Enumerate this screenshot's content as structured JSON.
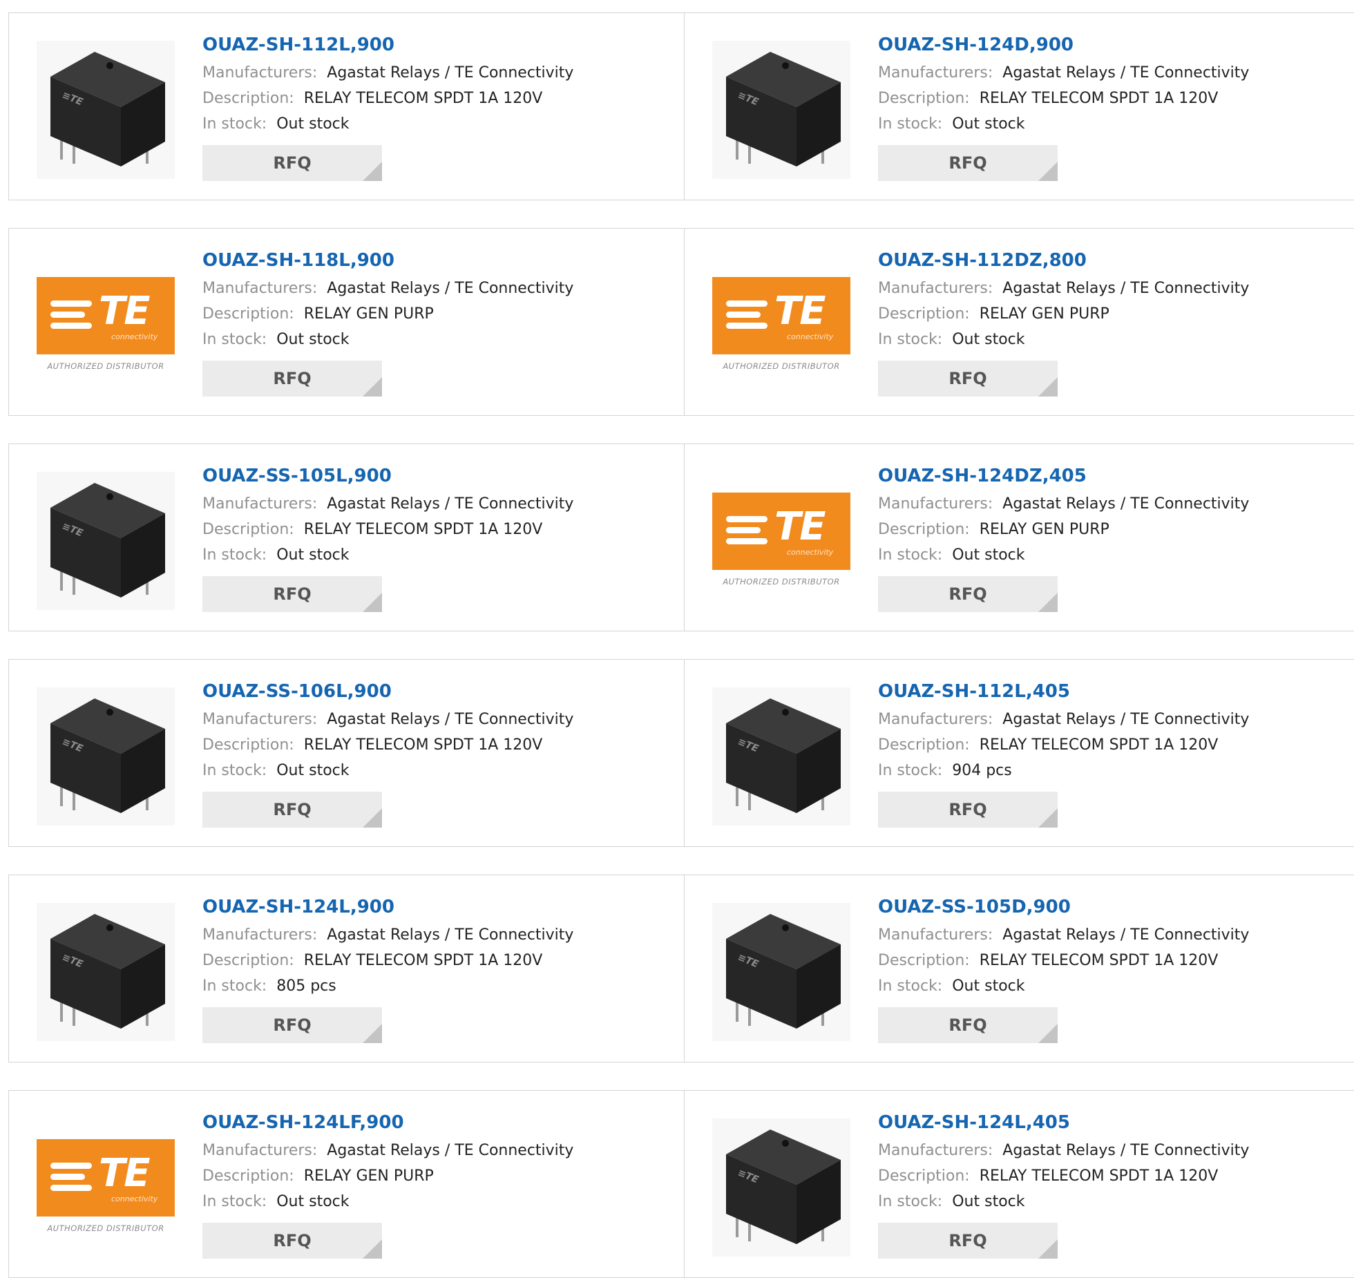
{
  "labels": {
    "manufacturers": "Manufacturers:",
    "description": "Description:",
    "stock": "In stock:",
    "rfq": "RFQ"
  },
  "logo": {
    "mark": "TE",
    "tagline": "connectivity",
    "distributor": "AUTHORIZED DISTRIBUTOR"
  },
  "colors": {
    "link": "#1565b0",
    "te_orange": "#f28b1e",
    "button": "#ebebeb"
  },
  "products": [
    {
      "part": "OUAZ-SH-112L,900",
      "manufacturer": "Agastat Relays / TE Connectivity",
      "description": "RELAY TELECOM SPDT 1A 120V",
      "stock": "Out stock",
      "image": "relay"
    },
    {
      "part": "OUAZ-SH-124D,900",
      "manufacturer": "Agastat Relays / TE Connectivity",
      "description": "RELAY TELECOM SPDT 1A 120V",
      "stock": "Out stock",
      "image": "relay"
    },
    {
      "part": "OUAZ-SH-118L,900",
      "manufacturer": "Agastat Relays / TE Connectivity",
      "description": "RELAY GEN PURP",
      "stock": "Out stock",
      "image": "te-logo"
    },
    {
      "part": "OUAZ-SH-112DZ,800",
      "manufacturer": "Agastat Relays / TE Connectivity",
      "description": "RELAY GEN PURP",
      "stock": "Out stock",
      "image": "te-logo"
    },
    {
      "part": "OUAZ-SS-105L,900",
      "manufacturer": "Agastat Relays / TE Connectivity",
      "description": "RELAY TELECOM SPDT 1A 120V",
      "stock": "Out stock",
      "image": "relay"
    },
    {
      "part": "OUAZ-SH-124DZ,405",
      "manufacturer": "Agastat Relays / TE Connectivity",
      "description": "RELAY GEN PURP",
      "stock": "Out stock",
      "image": "te-logo"
    },
    {
      "part": "OUAZ-SS-106L,900",
      "manufacturer": "Agastat Relays / TE Connectivity",
      "description": "RELAY TELECOM SPDT 1A 120V",
      "stock": "Out stock",
      "image": "relay"
    },
    {
      "part": "OUAZ-SH-112L,405",
      "manufacturer": "Agastat Relays / TE Connectivity",
      "description": "RELAY TELECOM SPDT 1A 120V",
      "stock": "904 pcs",
      "image": "relay"
    },
    {
      "part": "OUAZ-SH-124L,900",
      "manufacturer": "Agastat Relays / TE Connectivity",
      "description": "RELAY TELECOM SPDT 1A 120V",
      "stock": "805 pcs",
      "image": "relay"
    },
    {
      "part": "OUAZ-SS-105D,900",
      "manufacturer": "Agastat Relays / TE Connectivity",
      "description": "RELAY TELECOM SPDT 1A 120V",
      "stock": "Out stock",
      "image": "relay"
    },
    {
      "part": "OUAZ-SH-124LF,900",
      "manufacturer": "Agastat Relays / TE Connectivity",
      "description": "RELAY GEN PURP",
      "stock": "Out stock",
      "image": "te-logo"
    },
    {
      "part": "OUAZ-SH-124L,405",
      "manufacturer": "Agastat Relays / TE Connectivity",
      "description": "RELAY TELECOM SPDT 1A 120V",
      "stock": "Out stock",
      "image": "relay"
    }
  ]
}
